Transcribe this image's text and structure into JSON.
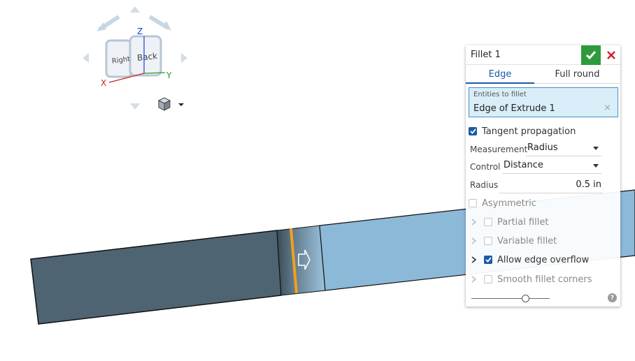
{
  "viewcube": {
    "axis_z": "Z",
    "axis_x": "X",
    "axis_y": "Y",
    "face_right": "Right",
    "face_back": "Back",
    "icons": [
      "rotate-arrow-icon",
      "pan-arrow-icon",
      "cube-view-icon",
      "chevron-down-icon"
    ]
  },
  "panel": {
    "title": "Fillet 1",
    "tabs": [
      "Edge",
      "Full round"
    ],
    "active_tab": "Edge",
    "entities_label": "Entities to fillet",
    "entities_value": "Edge of Extrude 1",
    "clear_glyph": "×",
    "tangent_label": "Tangent propagation",
    "tangent_checked": true,
    "measurement_label": "Measurement",
    "measurement_value": "Radius",
    "control_label": "Control",
    "control_value": "Distance",
    "radius_label": "Radius",
    "radius_value": "0.5 in",
    "asymmetric_label": "Asymmetric",
    "asymmetric_checked": false,
    "sections": [
      {
        "label": "Partial fillet",
        "checked": false
      },
      {
        "label": "Variable fillet",
        "checked": false
      },
      {
        "label": "Allow edge overflow",
        "checked": true
      },
      {
        "label": "Smooth fillet corners",
        "checked": false
      }
    ],
    "help_glyph": "?"
  },
  "colors": {
    "accent": "#1c5aa8",
    "ok_green": "#2f9a3c",
    "cancel_red": "#d0202a",
    "selected_edge": "#f0a020",
    "body_dark": "#4e6472",
    "body_light": "#8db9d8"
  }
}
